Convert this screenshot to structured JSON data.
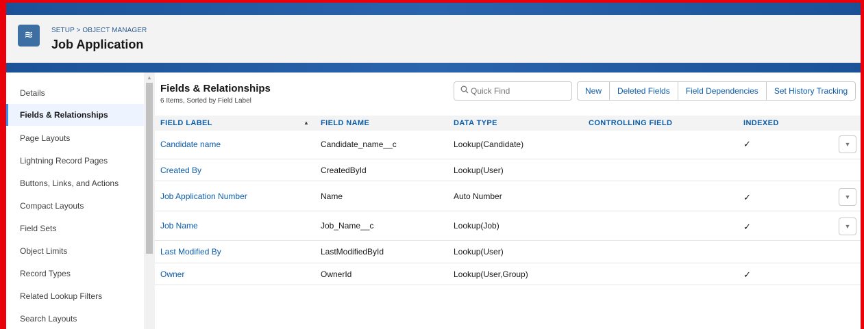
{
  "header": {
    "breadcrumb": "SETUP > OBJECT MANAGER",
    "title": "Job Application",
    "icon": "layers-icon"
  },
  "sidebar": {
    "items": [
      {
        "label": "Details",
        "active": false
      },
      {
        "label": "Fields & Relationships",
        "active": true
      },
      {
        "label": "Page Layouts",
        "active": false
      },
      {
        "label": "Lightning Record Pages",
        "active": false
      },
      {
        "label": "Buttons, Links, and Actions",
        "active": false
      },
      {
        "label": "Compact Layouts",
        "active": false
      },
      {
        "label": "Field Sets",
        "active": false
      },
      {
        "label": "Object Limits",
        "active": false
      },
      {
        "label": "Record Types",
        "active": false
      },
      {
        "label": "Related Lookup Filters",
        "active": false
      },
      {
        "label": "Search Layouts",
        "active": false
      }
    ]
  },
  "main": {
    "title": "Fields & Relationships",
    "subtitle": "6 Items, Sorted by Field Label",
    "quick_find_placeholder": "Quick Find",
    "buttons": [
      "New",
      "Deleted Fields",
      "Field Dependencies",
      "Set History Tracking"
    ],
    "columns": [
      "Field Label",
      "Field Name",
      "Data Type",
      "Controlling Field",
      "Indexed"
    ],
    "rows": [
      {
        "label": "Candidate name",
        "name": "Candidate_name__c",
        "type": "Lookup(Candidate)",
        "controlling": "",
        "indexed": true,
        "menu": true
      },
      {
        "label": "Created By",
        "name": "CreatedById",
        "type": "Lookup(User)",
        "controlling": "",
        "indexed": false,
        "menu": false
      },
      {
        "label": "Job Application Number",
        "name": "Name",
        "type": "Auto Number",
        "controlling": "",
        "indexed": true,
        "menu": true
      },
      {
        "label": "Job Name",
        "name": "Job_Name__c",
        "type": "Lookup(Job)",
        "controlling": "",
        "indexed": true,
        "menu": true
      },
      {
        "label": "Last Modified By",
        "name": "LastModifiedById",
        "type": "Lookup(User)",
        "controlling": "",
        "indexed": false,
        "menu": false
      },
      {
        "label": "Owner",
        "name": "OwnerId",
        "type": "Lookup(User,Group)",
        "controlling": "",
        "indexed": true,
        "menu": false
      }
    ]
  },
  "colors": {
    "accent": "#0b5cab",
    "banner": "#1b5297",
    "frame": "#e8000b",
    "active_bar": "#1b96ff"
  }
}
